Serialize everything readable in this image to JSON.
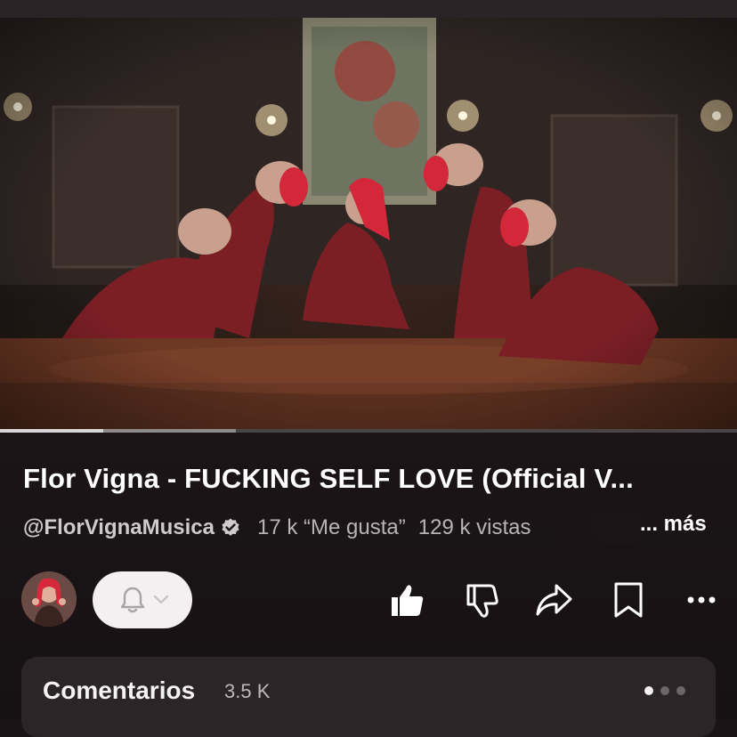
{
  "video": {
    "title": "Flor Vigna - FUCKING SELF LOVE (Official V...",
    "progress_percent": 14,
    "buffered_percent": 32
  },
  "channel": {
    "handle": "@FlorVignaMusica",
    "verified_icon": "verified-badge-icon"
  },
  "stats": {
    "likes": "17 k “Me gusta”",
    "views": "129 k vistas",
    "more_label": "... más"
  },
  "actions": {
    "subscribe_icon": "bell-icon",
    "like_icon": "thumbs-up-icon",
    "dislike_icon": "thumbs-down-icon",
    "share_icon": "share-arrow-icon",
    "save_icon": "bookmark-icon",
    "more_icon": "more-horizontal-icon"
  },
  "comments": {
    "title": "Comentarios",
    "count": "3.5 K",
    "pages": 3,
    "active_page": 1
  },
  "colors": {
    "background": "#1b1517",
    "pill": "#f2f0f1",
    "comments_card": "#2b2527",
    "secondary_text": "#bdb8ba"
  }
}
